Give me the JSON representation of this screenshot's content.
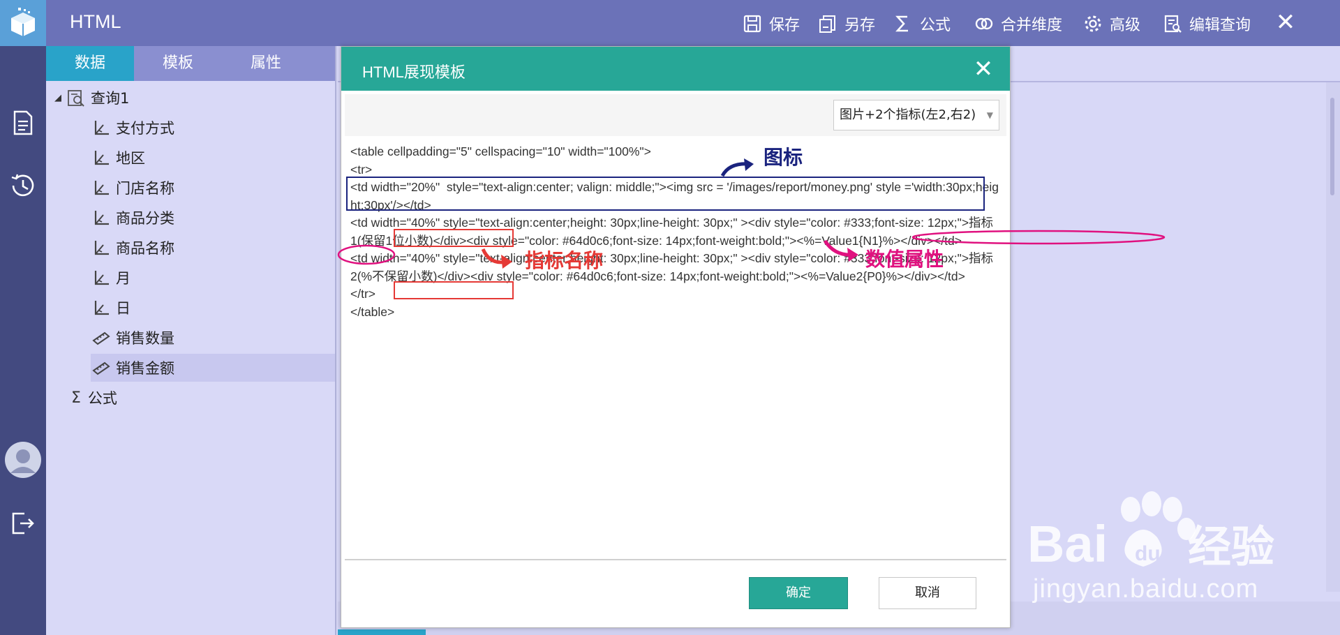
{
  "app": {
    "title": "HTML"
  },
  "toolbar": {
    "save": "保存",
    "save_as": "另存",
    "formula": "公式",
    "merge_dim": "合并维度",
    "advanced": "高级",
    "edit_query": "编辑查询",
    "close": "✕"
  },
  "panel": {
    "tabs": [
      "数据",
      "模板",
      "属性"
    ],
    "tree": {
      "query": "查询1",
      "dimensions": [
        "支付方式",
        "地区",
        "门店名称",
        "商品分类",
        "商品名称",
        "月",
        "日"
      ],
      "measures": [
        "销售数量",
        "销售金额"
      ],
      "formula": "公式"
    }
  },
  "modal": {
    "title": "HTML展现模板",
    "close": "✕",
    "template_select": "图片+2个指标(左2,右2)",
    "code_lines": [
      "<table cellpadding=\"5\" cellspacing=\"10\" width=\"100%\">",
      "<tr>",
      "<td width=\"20%\"  style=\"text-align:center; valign: middle;\"><img src = '/images/report/money.png' style ='width:30px;height:30px'/></td>",
      "<td width=\"40%\" style=\"text-align:center;height: 30px;line-height: 30px;\" ><div style=\"color: #333;font-size: 12px;\">指标1(保留1位小数)</div><div style=\"color: #64d0c6;font-size: 14px;font-weight:bold;\"><%=Value1{N1}%></div></td>",
      "<td width=\"40%\" style=\"text-align:center;height: 30px;line-height: 30px;\" ><div style=\"color: #333;font-size: 12px;\">指标2(%不保留小数)</div><div style=\"color: #64d0c6;font-size: 14px;font-weight:bold;\"><%=Value2{P0}%></div></td>",
      "</tr>",
      "</table>"
    ],
    "ok": "确定",
    "cancel": "取消"
  },
  "annotations": {
    "icon_label": "图标",
    "name_label": "指标名称",
    "value_label": "数值属性",
    "colors": {
      "blue": "#1a237e",
      "red": "#e53935",
      "pink": "#e0117f"
    }
  },
  "watermark": {
    "url": "jingyan.baidu.com",
    "brand": "Baidu经验"
  },
  "colors": {
    "topbar": "#6b72b8",
    "rail": "#434a80",
    "teal": "#27a797",
    "tab_active": "#29a3c9"
  }
}
